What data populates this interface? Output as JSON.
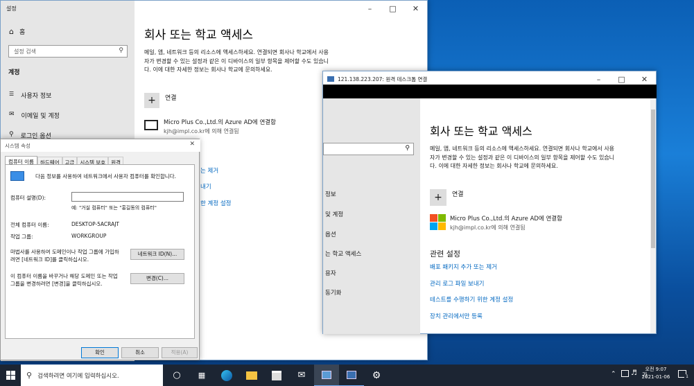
{
  "settings": {
    "title": "설정",
    "home": "홈",
    "search_placeholder": "설정 검색",
    "section": "계정",
    "nav": [
      "사용자 정보",
      "이메일 및 계정",
      "로그인 옵션"
    ],
    "heading": "회사 또는 학교 액세스",
    "description": "메일, 앱, 네트워크 등의 리소스에 액세스하세요. 연결되면 회사나 학교에서 사용자가 변경할 수 있는 설정과 같은 이 디바이스의 일부 항목을 제어할 수도 있습니다. 이에 대한 자세한 정보는 회사나 학교에 문의하세요.",
    "connect": "연결",
    "account_name": "Micro Plus Co.,Ltd.의 Azure AD에 연결함",
    "account_sub": "kjh@impl.co.kr에 의해 연결됨",
    "partial_links": [
      "는 제거",
      "내기",
      "한 계정 설정"
    ]
  },
  "sysprops": {
    "title": "시스템 속성",
    "tabs": [
      "컴퓨터 이름",
      "하드웨어",
      "고급",
      "시스템 보호",
      "원격"
    ],
    "intro": "다음 정보를 사용하여 네트워크에서 사용자 컴퓨터를 확인합니다.",
    "desc_label": "컴퓨터 설명(D):",
    "desc_value": "",
    "example": "예: \"거실 컴퓨터\" 또는 \"홍길동의 컴퓨터\"",
    "fullname_label": "전체 컴퓨터 이름:",
    "fullname_value": "DESKTOP-5ACRAJT",
    "workgroup_label": "작업 그룹:",
    "workgroup_value": "WORKGROUP",
    "network_text": "마법사를 사용하여 도메인이나 작업 그룹에 가입하려면 [네트워크 ID]를 클릭하십시오.",
    "network_btn": "네트워크 ID(N)...",
    "change_text": "이 컴퓨터 이름을 바꾸거나 해당 도메인 또는 작업 그룹을 변경하려면 [변경]을 클릭하십시오.",
    "change_btn": "변경(C)...",
    "ok": "확인",
    "cancel": "취소",
    "apply": "적용(A)"
  },
  "rdp": {
    "title": "121.138.223.207: 원격 데스크톱 연결",
    "heading": "회사 또는 학교 액세스",
    "description": "메일, 앱, 네트워크 등의 리소스에 액세스하세요. 연결되면 회사나 학교에서 사용자가 변경할 수 있는 설정과 같은 이 디바이스의 일부 항목을 제어할 수도 있습니다. 이에 대한 자세한 정보는 회사나 학교에 문의하세요.",
    "connect": "연결",
    "account_name": "Micro Plus Co.,Ltd.의 Azure AD에 연결함",
    "account_sub": "kjh@impl.co.kr에 의해 연결됨",
    "related": "관련 설정",
    "links": [
      "배포 패키지 추가 또는 제거",
      "관리 로그 파일 보내기",
      "테스트를 수행하기 위한 계정 설정",
      "장치 관리에서만 등록"
    ],
    "partial_nav": [
      "정보",
      "및 계정",
      "옵션",
      "는 학교 액세스",
      "용자",
      "동기화"
    ]
  },
  "taskbar": {
    "search_placeholder": "검색하려면 여기에 입력하십시오.",
    "ime": "가",
    "time": "오전 9:07",
    "date": "2021-01-06",
    "notification_count": "1"
  }
}
